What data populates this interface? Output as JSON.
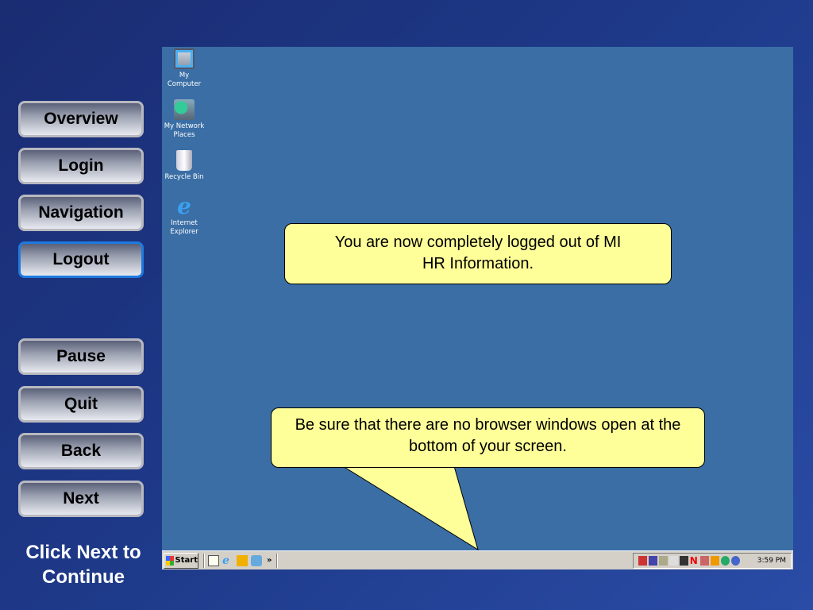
{
  "nav": {
    "buttons": [
      "Overview",
      "Login",
      "Navigation",
      "Logout"
    ],
    "active": "Logout"
  },
  "controls": {
    "pause": "Pause",
    "quit": "Quit",
    "back": "Back",
    "next": "Next"
  },
  "continue_text": "Click Next to Continue",
  "desktop": {
    "icons": [
      "My Computer",
      "My Network Places",
      "Recycle Bin",
      "Internet Explorer"
    ]
  },
  "callouts": {
    "logged_out": "You are now completely logged out of MI HR Information.",
    "browser_windows": "Be sure that there are no browser windows open at the bottom of your screen."
  },
  "taskbar": {
    "start": "Start",
    "chevron": "»",
    "clock": "3:59 PM"
  }
}
